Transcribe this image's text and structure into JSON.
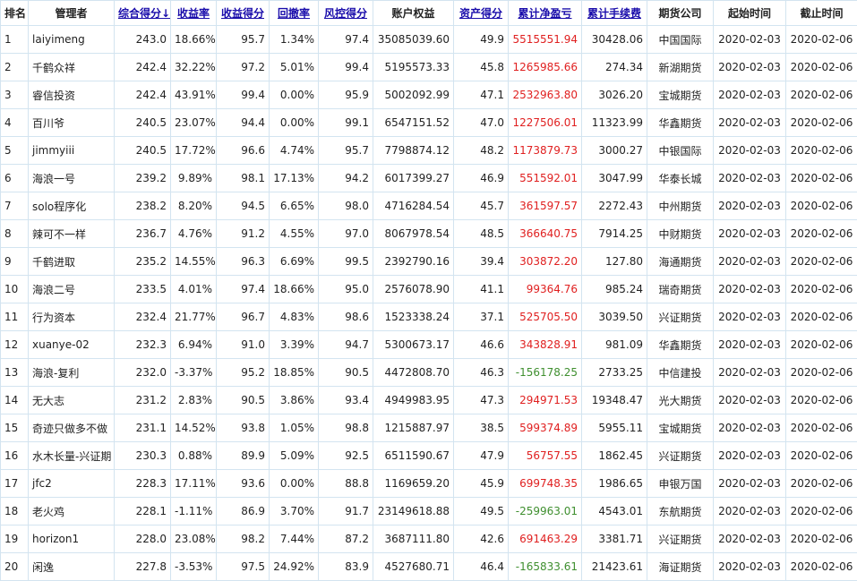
{
  "columns": [
    {
      "label": "排名",
      "sortable": false
    },
    {
      "label": "管理者",
      "sortable": false
    },
    {
      "label": "综合得分↓",
      "sortable": true
    },
    {
      "label": "收益率",
      "sortable": true
    },
    {
      "label": "收益得分",
      "sortable": true
    },
    {
      "label": "回撤率",
      "sortable": true
    },
    {
      "label": "风控得分",
      "sortable": true
    },
    {
      "label": "账户权益",
      "sortable": false
    },
    {
      "label": "资产得分",
      "sortable": true
    },
    {
      "label": "累计净盈亏",
      "sortable": true
    },
    {
      "label": "累计手续费",
      "sortable": true
    },
    {
      "label": "期货公司",
      "sortable": false
    },
    {
      "label": "起始时间",
      "sortable": false
    },
    {
      "label": "截止时间",
      "sortable": false
    }
  ],
  "colors": {
    "link": "#1a0dab",
    "profit": "#e02020",
    "loss": "#3f8f2f",
    "grid": "#d3e4f0"
  },
  "rows": [
    [
      "1",
      "laiyimeng",
      "243.0",
      "18.66%",
      "95.7",
      "1.34%",
      "97.4",
      "35085039.60",
      "49.9",
      "5515551.94",
      "30428.06",
      "中国国际",
      "2020-02-03",
      "2020-02-06"
    ],
    [
      "2",
      "千鹤众祥",
      "242.4",
      "32.22%",
      "97.2",
      "5.01%",
      "99.4",
      "5195573.33",
      "45.8",
      "1265985.66",
      "274.34",
      "新湖期货",
      "2020-02-03",
      "2020-02-06"
    ],
    [
      "3",
      "睿信投资",
      "242.4",
      "43.91%",
      "99.4",
      "0.00%",
      "95.9",
      "5002092.99",
      "47.1",
      "2532963.80",
      "3026.20",
      "宝城期货",
      "2020-02-03",
      "2020-02-06"
    ],
    [
      "4",
      "百川爷",
      "240.5",
      "23.07%",
      "94.4",
      "0.00%",
      "99.1",
      "6547151.52",
      "47.0",
      "1227506.01",
      "11323.99",
      "华鑫期货",
      "2020-02-03",
      "2020-02-06"
    ],
    [
      "5",
      "jimmyiii",
      "240.5",
      "17.72%",
      "96.6",
      "4.74%",
      "95.7",
      "7798874.12",
      "48.2",
      "1173879.73",
      "3000.27",
      "中银国际",
      "2020-02-03",
      "2020-02-06"
    ],
    [
      "6",
      "海浪一号",
      "239.2",
      "9.89%",
      "98.1",
      "17.13%",
      "94.2",
      "6017399.27",
      "46.9",
      "551592.01",
      "3047.99",
      "华泰长城",
      "2020-02-03",
      "2020-02-06"
    ],
    [
      "7",
      "solo程序化",
      "238.2",
      "8.20%",
      "94.5",
      "6.65%",
      "98.0",
      "4716284.54",
      "45.7",
      "361597.57",
      "2272.43",
      "中州期货",
      "2020-02-03",
      "2020-02-06"
    ],
    [
      "8",
      "辣可不一样",
      "236.7",
      "4.76%",
      "91.2",
      "4.55%",
      "97.0",
      "8067978.54",
      "48.5",
      "366640.75",
      "7914.25",
      "中财期货",
      "2020-02-03",
      "2020-02-06"
    ],
    [
      "9",
      "千鹤进取",
      "235.2",
      "14.55%",
      "96.3",
      "6.69%",
      "99.5",
      "2392790.16",
      "39.4",
      "303872.20",
      "127.80",
      "海通期货",
      "2020-02-03",
      "2020-02-06"
    ],
    [
      "10",
      "海浪二号",
      "233.5",
      "4.01%",
      "97.4",
      "18.66%",
      "95.0",
      "2576078.90",
      "41.1",
      "99364.76",
      "985.24",
      "瑞奇期货",
      "2020-02-03",
      "2020-02-06"
    ],
    [
      "11",
      "行为资本",
      "232.4",
      "21.77%",
      "96.7",
      "4.83%",
      "98.6",
      "1523338.24",
      "37.1",
      "525705.50",
      "3039.50",
      "兴证期货",
      "2020-02-03",
      "2020-02-06"
    ],
    [
      "12",
      "xuanye-02",
      "232.3",
      "6.94%",
      "91.0",
      "3.39%",
      "94.7",
      "5300673.17",
      "46.6",
      "343828.91",
      "981.09",
      "华鑫期货",
      "2020-02-03",
      "2020-02-06"
    ],
    [
      "13",
      "海浪-复利",
      "232.0",
      "-3.37%",
      "95.2",
      "18.85%",
      "90.5",
      "4472808.70",
      "46.3",
      "-156178.25",
      "2733.25",
      "中信建投",
      "2020-02-03",
      "2020-02-06"
    ],
    [
      "14",
      "无大志",
      "231.2",
      "2.83%",
      "90.5",
      "3.86%",
      "93.4",
      "4949983.95",
      "47.3",
      "294971.53",
      "19348.47",
      "光大期货",
      "2020-02-03",
      "2020-02-06"
    ],
    [
      "15",
      "奇迹只做多不做",
      "231.1",
      "14.52%",
      "93.8",
      "1.05%",
      "98.8",
      "1215887.97",
      "38.5",
      "599374.89",
      "5955.11",
      "宝城期货",
      "2020-02-03",
      "2020-02-06"
    ],
    [
      "16",
      "水木长量-兴证期",
      "230.3",
      "0.88%",
      "89.9",
      "5.09%",
      "92.5",
      "6511590.67",
      "47.9",
      "56757.55",
      "1862.45",
      "兴证期货",
      "2020-02-03",
      "2020-02-06"
    ],
    [
      "17",
      "jfc2",
      "228.3",
      "17.11%",
      "93.6",
      "0.00%",
      "88.8",
      "1169659.20",
      "45.9",
      "699748.35",
      "1986.65",
      "申银万国",
      "2020-02-03",
      "2020-02-06"
    ],
    [
      "18",
      "老火鸡",
      "228.1",
      "-1.11%",
      "86.9",
      "3.70%",
      "91.7",
      "23149618.88",
      "49.5",
      "-259963.01",
      "4543.01",
      "东航期货",
      "2020-02-03",
      "2020-02-06"
    ],
    [
      "19",
      "horizon1",
      "228.0",
      "23.08%",
      "98.2",
      "7.44%",
      "87.2",
      "3687111.80",
      "42.6",
      "691463.29",
      "3381.71",
      "兴证期货",
      "2020-02-03",
      "2020-02-06"
    ],
    [
      "20",
      "闲逸",
      "227.8",
      "-3.53%",
      "97.5",
      "24.92%",
      "83.9",
      "4527680.71",
      "46.4",
      "-165833.61",
      "21423.61",
      "海证期货",
      "2020-02-03",
      "2020-02-06"
    ]
  ]
}
